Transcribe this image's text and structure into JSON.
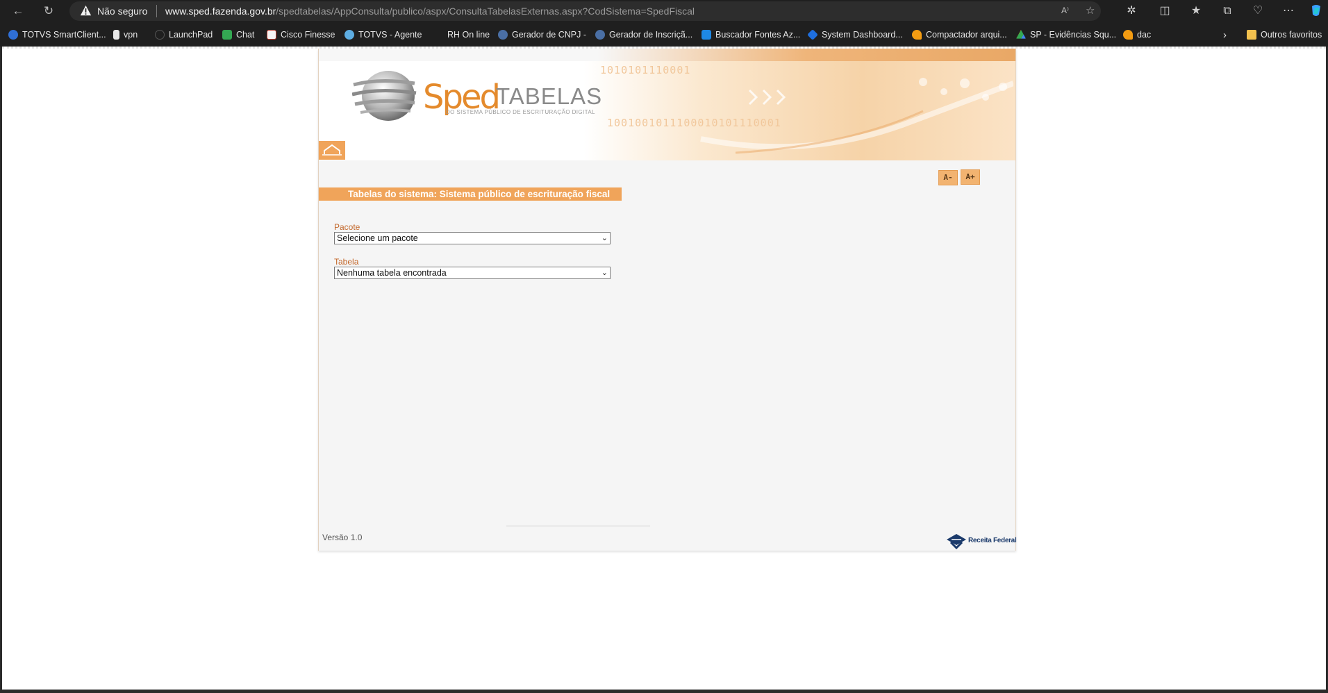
{
  "browser": {
    "security_label": "Não seguro",
    "url_host": "www.sped.fazenda.gov.br",
    "url_path": "/spedtabelas/AppConsulta/publico/aspx/ConsultaTabelasExternas.aspx?CodSistema=SpedFiscal",
    "read_aloud_label": "A⁾"
  },
  "bookmarks": [
    {
      "label": "TOTVS SmartClient...",
      "color": "#2f6fd6"
    },
    {
      "label": "vpn",
      "color": "#e8e8e8"
    },
    {
      "label": "LaunchPad",
      "color": "#555555"
    },
    {
      "label": "Chat",
      "color": "#34a853"
    },
    {
      "label": "Cisco Finesse",
      "color": "#c0392b"
    },
    {
      "label": "TOTVS - Agente",
      "color": "#5dade2"
    },
    {
      "label": "RH On line",
      "color": "#1f1f1f"
    },
    {
      "label": "Gerador de CNPJ -",
      "color": "#4a6fa5"
    },
    {
      "label": "Gerador de Inscriçã...",
      "color": "#4a6fa5"
    },
    {
      "label": "Buscador Fontes Az...",
      "color": "#1e88e5"
    },
    {
      "label": "System Dashboard...",
      "color": "#1e6fe0"
    },
    {
      "label": "Compactador arqui...",
      "color": "#f39c12"
    },
    {
      "label": "SP - Evidências Squ...",
      "color": "#34a853"
    },
    {
      "label": "dac",
      "color": "#f39c12"
    }
  ],
  "other_favorites": "Outros favoritos",
  "site": {
    "logo_sped": "Sped",
    "logo_tabelas": "TABELAS",
    "logo_subtitle": "DO SISTEMA PÚBLICO DE ESCRITURAÇÃO DIGITAL",
    "banner_binary_1": "1010101110001",
    "banner_binary_2": "1001001011100010101110001",
    "font_decrease": "A-",
    "font_increase": "A+",
    "title": "Tabelas do sistema: Sistema público de escrituração fiscal",
    "pacote_label": "Pacote",
    "pacote_value": "Selecione um pacote",
    "tabela_label": "Tabela",
    "tabela_value": "Nenhuma tabela encontrada",
    "version": "Versão 1.0",
    "rf_logo_text": "Receita Federal",
    "accent_color": "#f0a45a"
  }
}
